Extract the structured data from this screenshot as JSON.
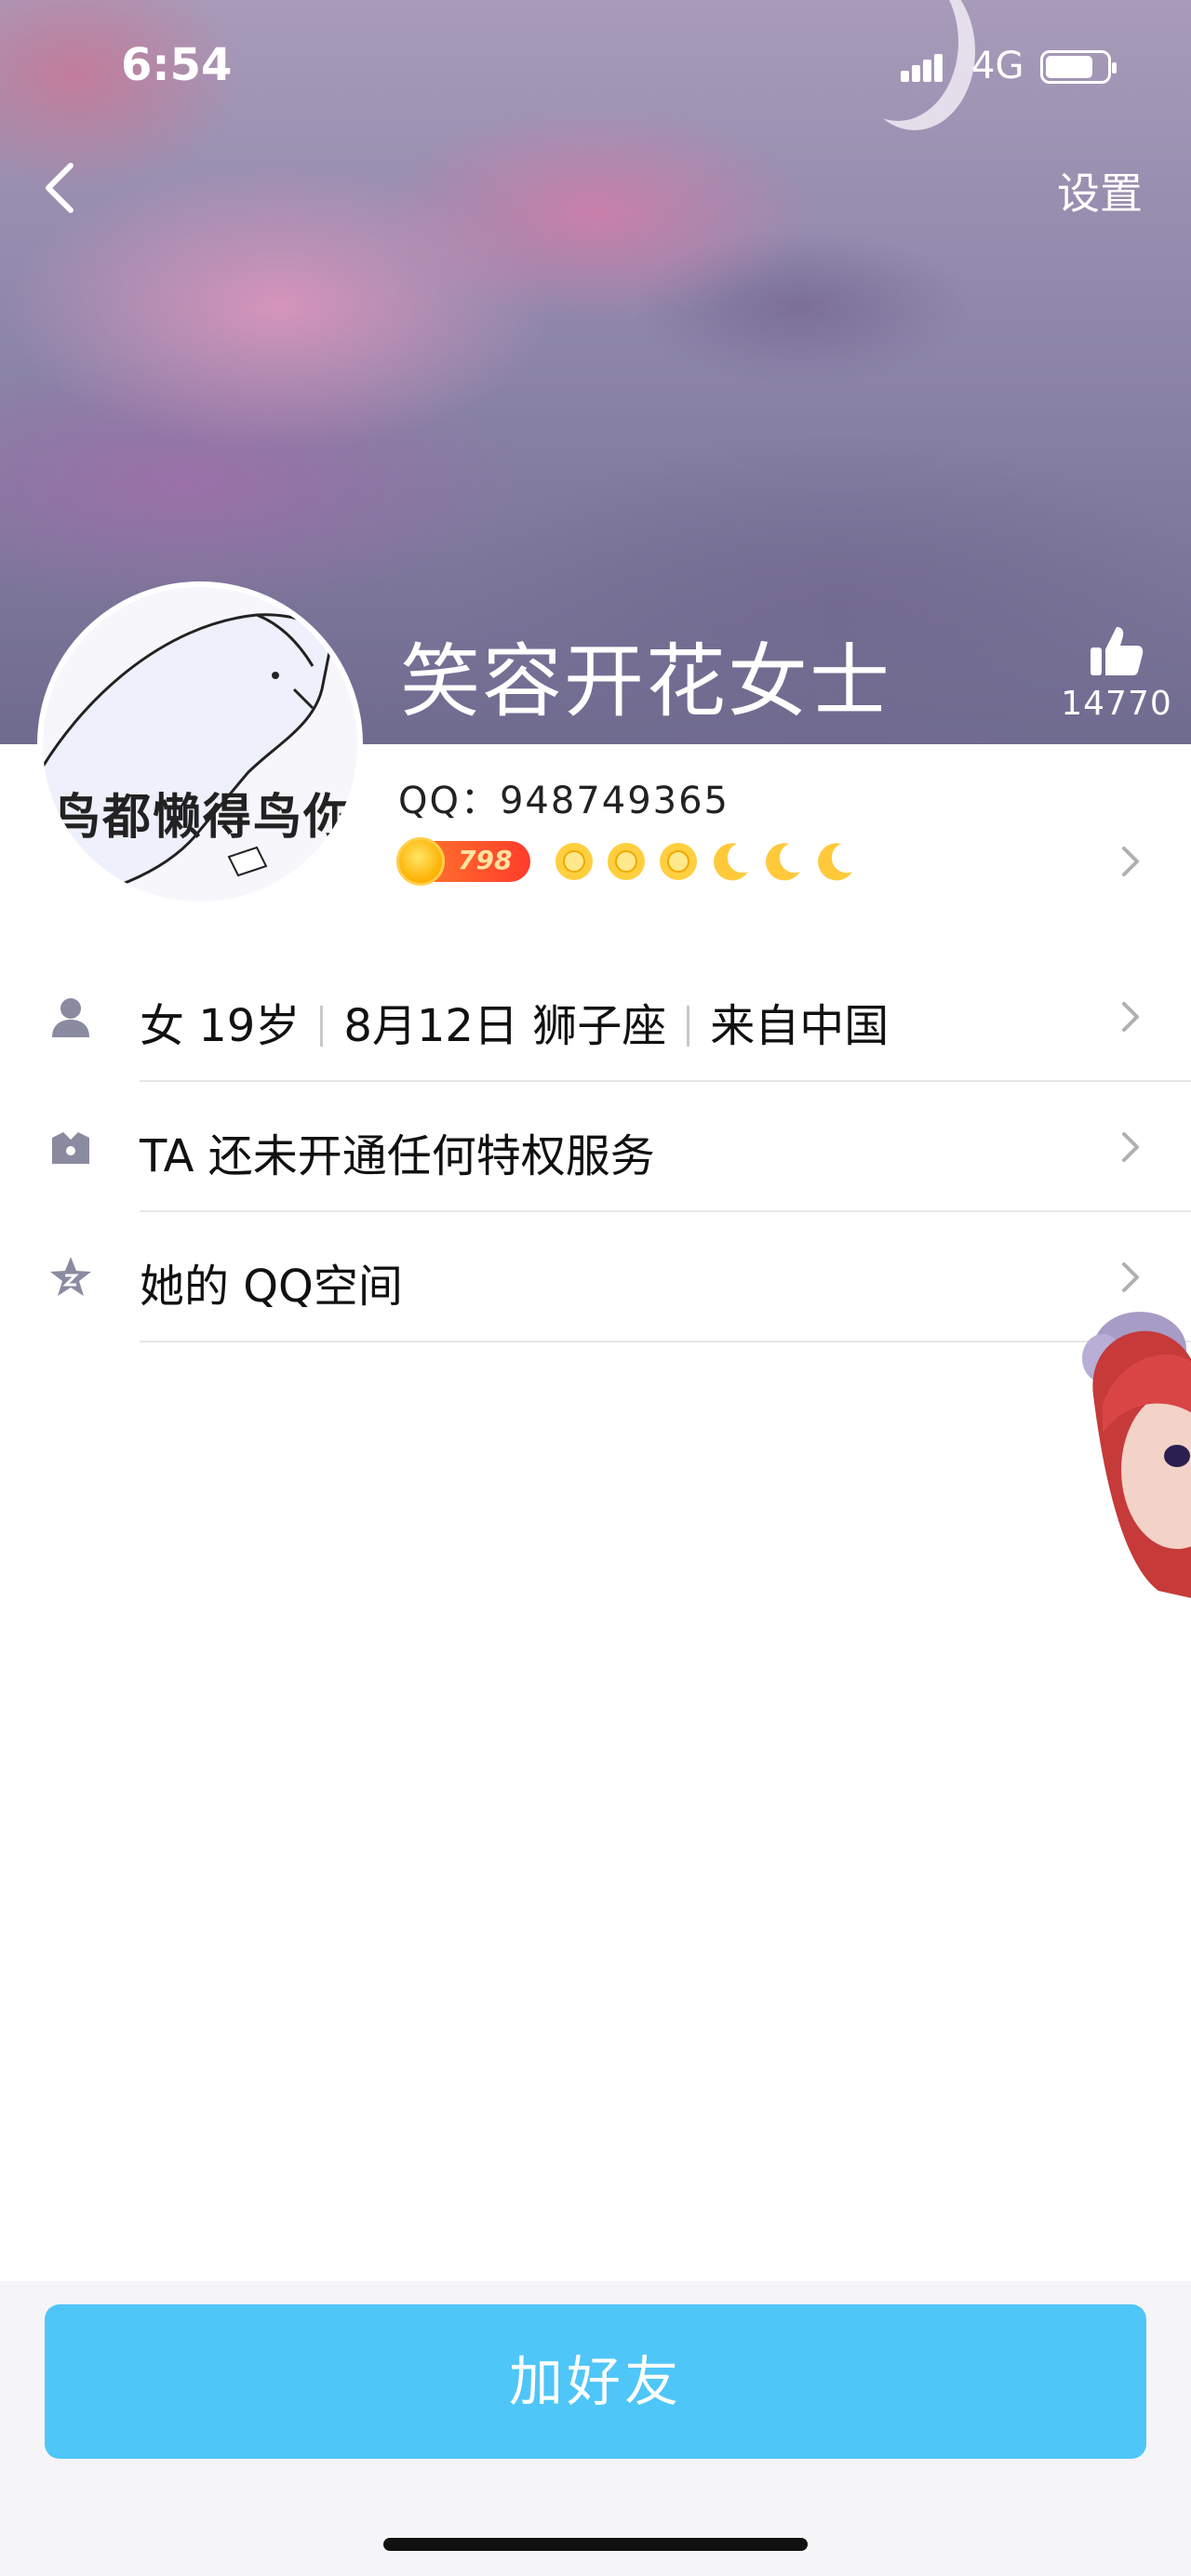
{
  "status_bar": {
    "time": "6:54",
    "network": "4G"
  },
  "header": {
    "settings_label": "设置",
    "nickname": "笑容开花女士",
    "like_count": "14770"
  },
  "avatar": {
    "caption": "鸟都懒得鸟你"
  },
  "profile": {
    "qq_label": "QQ：948749365",
    "vip_level": "798",
    "level_icons": [
      "sun",
      "sun",
      "sun",
      "moon",
      "moon",
      "moon"
    ]
  },
  "info_rows": [
    {
      "icon": "person-icon",
      "parts": [
        "女 19岁",
        "8月12日 狮子座",
        "来自中国"
      ]
    },
    {
      "icon": "crown-icon",
      "text": "TA 还未开通任何特权服务"
    },
    {
      "icon": "star-icon",
      "text": "她的 QQ空间"
    }
  ],
  "actions": {
    "add_friend_label": "加好友"
  },
  "colors": {
    "accent": "#4fc6f8",
    "icon_gray": "#8a8aa0"
  }
}
